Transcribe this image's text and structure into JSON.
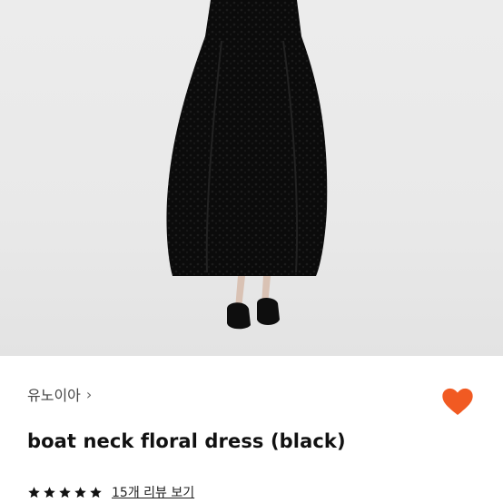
{
  "product": {
    "seller_name": "유노이아",
    "chevron_glyph": "›",
    "title": "boat neck floral dress (black)",
    "rating_stars": 5,
    "reviews_link": "15개 리뷰 보기",
    "heart_color": "#f15a22",
    "star_color": "#111111"
  }
}
